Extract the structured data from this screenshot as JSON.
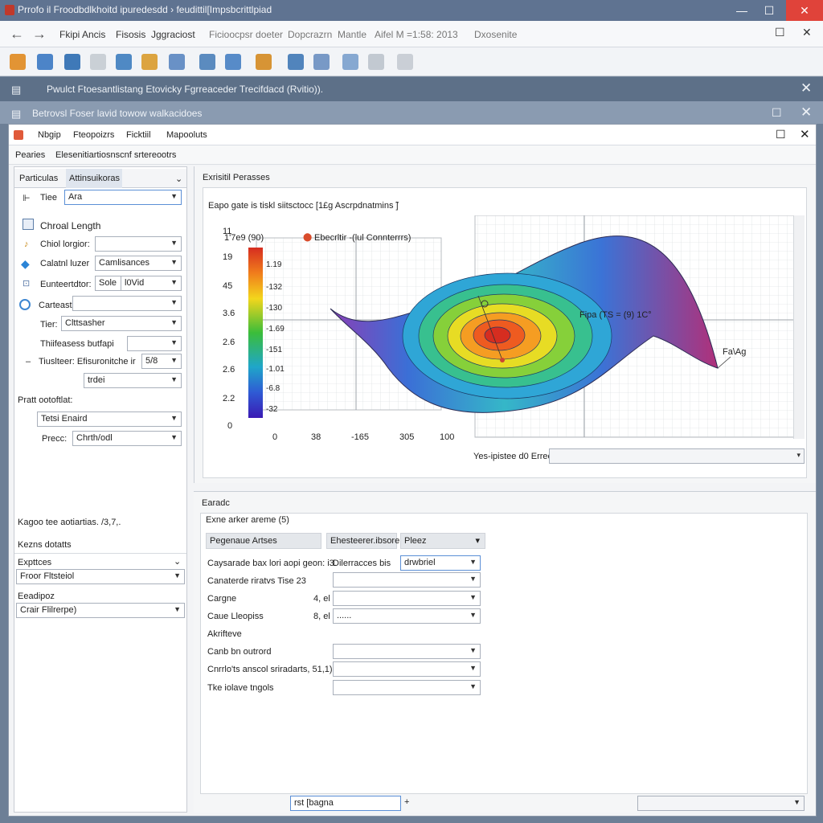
{
  "window": {
    "title": "Prrofo il Froodbdlkhoitd ipuredesdd › feudittil[Impsbcrittlpiad",
    "min": "—",
    "max": "☐",
    "close": "✕"
  },
  "menu": {
    "back": "←",
    "forward": "→",
    "items": [
      "Fkipi",
      "Ancis",
      "Fisosis",
      "Jggraciost",
      "Ficioocpsr doeter",
      "Dopcrazrn",
      "Mantle",
      "Aifel M =1:58: 2013",
      "Dxosenite"
    ],
    "max": "☐",
    "close": "✕"
  },
  "toolbar": {
    "icons": [
      "home-icon",
      "chart-icon",
      "save-icon",
      "print-icon",
      "image-icon",
      "shapes-icon",
      "grid-icon",
      "layers-icon",
      "table-icon",
      "edit-icon",
      "export-icon",
      "window-icon",
      "tiles-icon",
      "refresh-icon",
      "arrow-right-icon"
    ],
    "colors": [
      "#e08a1e",
      "#3a78c2",
      "#2b6cb0",
      "#9aa3ad",
      "#3d7dbe",
      "#d99b2b",
      "#5a86c0",
      "#4a7fb8",
      "#4680c2",
      "#d4891f",
      "#3f78b5",
      "#6a8fc0",
      "#7aa0cc",
      "#8894a2",
      "#9aa2ad"
    ]
  },
  "band1": {
    "title": "Pwulct  Ftoesantlistang  Etovicky  Fgrreaceder  Trecifdacd (Rvitio)).",
    "close": "✕"
  },
  "band2": {
    "title": "Betrovsl    Foser lavid towow walkacidoes",
    "max": "☐",
    "close": "✕"
  },
  "inner": {
    "menu": [
      "Nbgip",
      "Fteopoizrs",
      "Ficktiil",
      "Mapooluts"
    ],
    "max": "☐",
    "close": "✕",
    "breadcrumb": [
      "Pearies",
      "Elesenitiartiosnscnf srtereootrs"
    ]
  },
  "left": {
    "tabs": [
      "Particulas",
      "Attinsuikoras"
    ],
    "tab_dd": "⌄",
    "tree_marker": "⊩",
    "tiee_label": "Tiee",
    "tiee_value": "Ara",
    "section1": "Chroal Length",
    "chord_label": "Chiol lorgior:",
    "chord_value": "",
    "catalyst_label": "Calatnl luzer",
    "catalyst_value": "Camlisances",
    "constr_label": "Eunteertdtor:",
    "constr_value1": "Sole",
    "constr_value2": "l0Vid",
    "cartest_label": "Carteast",
    "cartest_value": "",
    "tier_label": "Tier:",
    "tier_value": "Clttsasher",
    "thick_label": "Thiifeasess butfapi",
    "thick_value": "",
    "cluster_label": "Tiuslteer: Efisuronitche ir",
    "cluster_value": "5/8",
    "trdei_value": "trdei",
    "section2": "Pratt ootoftlat:",
    "tetsi_label": "Tetsi Enaird",
    "precc_label": "Precc:",
    "precc_value": "Chrth/odl",
    "note": "Kagoo tee aotiartias. /3,7,.",
    "section3": "Kezns dotatts",
    "exp_label": "Expttces",
    "exp_value": "Froor Fltsteiol",
    "ead_label": "Eeadipoz",
    "ead_value": "Crair Flilrerpe)"
  },
  "chart_panel": {
    "header": "Exrisitil Perasses",
    "subtitle": "Eapo gate is tiskl siitsctocc [1£g Ascrpdnatmins  ̃]",
    "colorbar_title": "1'7e9 (90)",
    "legend_icon": "⬤",
    "legend_text": "Ebecrltir -(lul Connterrrs)",
    "annotation": "Fipa (TS = (9) 1C°",
    "end_label": "Fa\\Ag",
    "ylabels": [
      "11",
      "19",
      "45",
      "3.6",
      "2.6",
      "2.6",
      "2.2",
      "0"
    ],
    "cb_labels": [
      "1.19",
      "-132",
      "-130",
      "-1.69",
      "-151",
      "-1.01",
      "-6.8",
      "-32"
    ],
    "xlabels": [
      "0",
      "38",
      "-165",
      "305",
      "100"
    ],
    "footer_label": "Yes-ipistee d0 Erreez",
    "footer_value": ""
  },
  "bottom_panel": {
    "header": "Earadc",
    "subtitle": "Exne arker areme (5)",
    "hdr1": "Pegenaue Artses",
    "hdr2": "Ehesteerer.ibsorer",
    "hdr3": "Pleez",
    "rows": [
      {
        "label": "Caysarade bax lori aopi geon: i3.",
        "extra": "Dilerracces bis",
        "value": "drwbriel"
      },
      {
        "label": "Canaterde riratvs Tise 23",
        "extra": "",
        "value": ""
      },
      {
        "label": "Cargne",
        "extra": "4, el",
        "value": ""
      },
      {
        "label": "Caue Lleopiss",
        "extra": "8, el",
        "value": "......"
      },
      {
        "label": "Akrifteve",
        "extra": "",
        "value": null
      },
      {
        "label": "Canb bn outrord",
        "extra": "",
        "value": ""
      },
      {
        "label": "Cnrrlo'ts anscol sriradarts, 51,1)",
        "extra": "",
        "value": ""
      },
      {
        "label": "Tke iolave tngols",
        "extra": "",
        "value": ""
      }
    ],
    "status_value": "rst [bagna",
    "status_btn": "+",
    "status_right": ""
  }
}
